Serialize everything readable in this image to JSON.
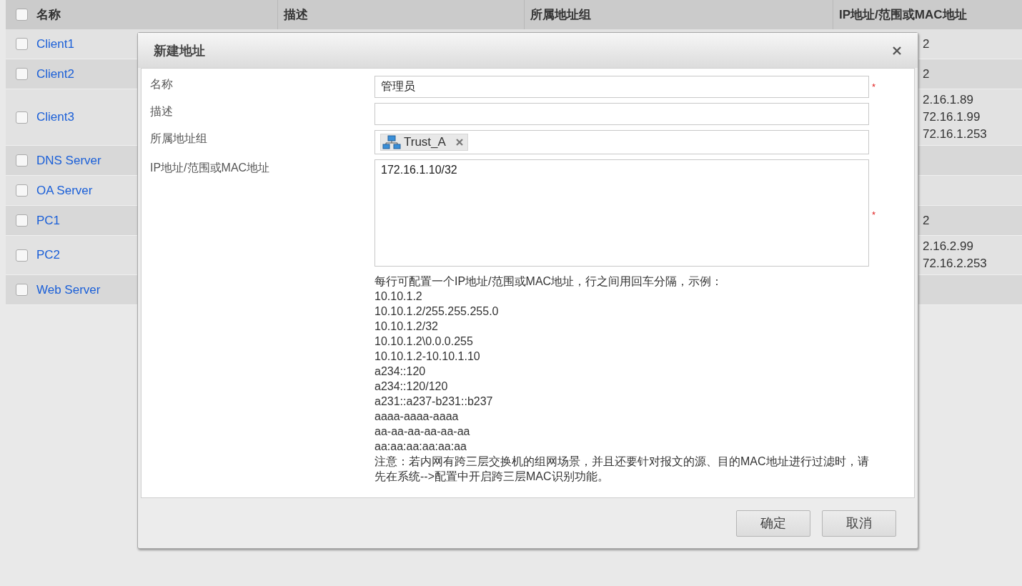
{
  "table": {
    "select_all": {
      "checked": false
    },
    "columns": [
      {
        "label": "名称"
      },
      {
        "label": "描述"
      },
      {
        "label": "所属地址组"
      },
      {
        "label": "IP地址/范围或MAC地址"
      }
    ],
    "rows": [
      {
        "name": "Client1",
        "checked": false,
        "ip_lines": [
          "2"
        ]
      },
      {
        "name": "Client2",
        "checked": false,
        "ip_lines": [
          "2"
        ]
      },
      {
        "name": "Client3",
        "checked": false,
        "ip_lines": [
          "2.16.1.89",
          "72.16.1.99",
          "72.16.1.253"
        ]
      },
      {
        "name": "DNS Server",
        "checked": false,
        "ip_lines": []
      },
      {
        "name": "OA Server",
        "checked": false,
        "ip_lines": []
      },
      {
        "name": "PC1",
        "checked": false,
        "ip_lines": [
          "2"
        ]
      },
      {
        "name": "PC2",
        "checked": false,
        "ip_lines": [
          "2.16.2.99",
          "72.16.2.253"
        ]
      },
      {
        "name": "Web Server",
        "checked": false,
        "ip_lines": []
      }
    ]
  },
  "dialog": {
    "title": "新建地址",
    "fields": [
      {
        "kind": "text",
        "label": "名称",
        "value": "管理员",
        "required_mark": "*"
      },
      {
        "kind": "text",
        "label": "描述"
      },
      {
        "kind": "tags",
        "label": "所属地址组",
        "tags": [
          {
            "label": "Trust_A"
          }
        ]
      },
      {
        "kind": "textarea",
        "label": "IP地址/范围或MAC地址",
        "value": "172.16.1.10/32",
        "required_mark": "*"
      }
    ],
    "help_lines": [
      "每行可配置一个IP地址/范围或MAC地址，行之间用回车分隔，示例：",
      "10.10.1.2",
      "10.10.1.2/255.255.255.0",
      "10.10.1.2/32",
      "10.10.1.2\\0.0.0.255",
      "10.10.1.2-10.10.1.10",
      "a234::120",
      "a234::120/120",
      "a231::a237-b231::b237",
      "aaaa-aaaa-aaaa",
      "aa-aa-aa-aa-aa-aa",
      "aa:aa:aa:aa:aa:aa"
    ],
    "note": "注意：若内网有跨三层交换机的组网场景，并且还要针对报文的源、目的MAC地址进行过滤时，请先在系统-->配置中开启跨三层MAC识别功能。",
    "buttons": [
      "确定",
      "取消"
    ]
  }
}
